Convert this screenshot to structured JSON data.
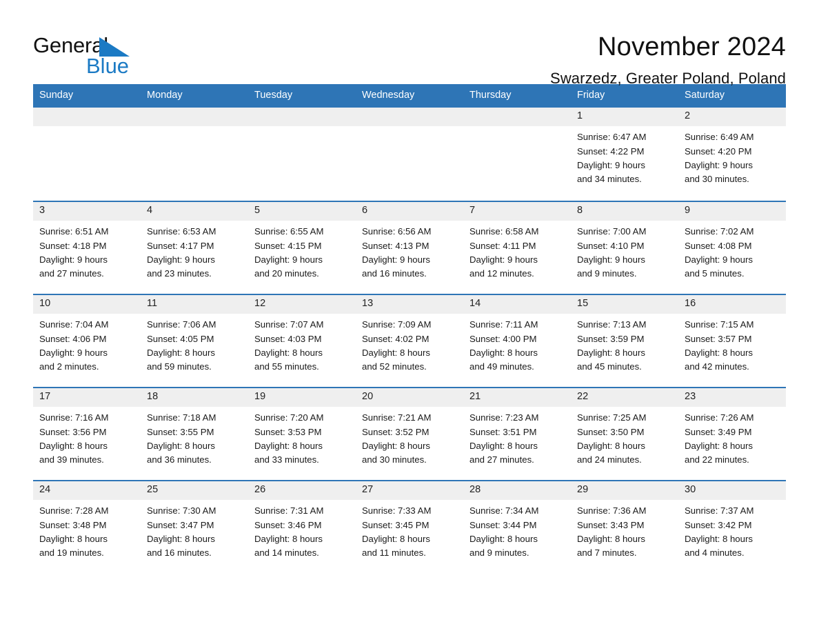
{
  "brand": {
    "name_part1": "General",
    "name_part2": "Blue",
    "accent_color": "#1b7ac4"
  },
  "header": {
    "title": "November 2024",
    "location": "Swarzedz, Greater Poland, Poland"
  },
  "theme": {
    "header_blue": "#2e75b6",
    "day_band_gray": "#efefef"
  },
  "weekdays": [
    "Sunday",
    "Monday",
    "Tuesday",
    "Wednesday",
    "Thursday",
    "Friday",
    "Saturday"
  ],
  "weeks": [
    [
      {
        "day": "",
        "lines": []
      },
      {
        "day": "",
        "lines": []
      },
      {
        "day": "",
        "lines": []
      },
      {
        "day": "",
        "lines": []
      },
      {
        "day": "",
        "lines": []
      },
      {
        "day": "1",
        "lines": [
          "Sunrise: 6:47 AM",
          "Sunset: 4:22 PM",
          "Daylight: 9 hours",
          "and 34 minutes."
        ]
      },
      {
        "day": "2",
        "lines": [
          "Sunrise: 6:49 AM",
          "Sunset: 4:20 PM",
          "Daylight: 9 hours",
          "and 30 minutes."
        ]
      }
    ],
    [
      {
        "day": "3",
        "lines": [
          "Sunrise: 6:51 AM",
          "Sunset: 4:18 PM",
          "Daylight: 9 hours",
          "and 27 minutes."
        ]
      },
      {
        "day": "4",
        "lines": [
          "Sunrise: 6:53 AM",
          "Sunset: 4:17 PM",
          "Daylight: 9 hours",
          "and 23 minutes."
        ]
      },
      {
        "day": "5",
        "lines": [
          "Sunrise: 6:55 AM",
          "Sunset: 4:15 PM",
          "Daylight: 9 hours",
          "and 20 minutes."
        ]
      },
      {
        "day": "6",
        "lines": [
          "Sunrise: 6:56 AM",
          "Sunset: 4:13 PM",
          "Daylight: 9 hours",
          "and 16 minutes."
        ]
      },
      {
        "day": "7",
        "lines": [
          "Sunrise: 6:58 AM",
          "Sunset: 4:11 PM",
          "Daylight: 9 hours",
          "and 12 minutes."
        ]
      },
      {
        "day": "8",
        "lines": [
          "Sunrise: 7:00 AM",
          "Sunset: 4:10 PM",
          "Daylight: 9 hours",
          "and 9 minutes."
        ]
      },
      {
        "day": "9",
        "lines": [
          "Sunrise: 7:02 AM",
          "Sunset: 4:08 PM",
          "Daylight: 9 hours",
          "and 5 minutes."
        ]
      }
    ],
    [
      {
        "day": "10",
        "lines": [
          "Sunrise: 7:04 AM",
          "Sunset: 4:06 PM",
          "Daylight: 9 hours",
          "and 2 minutes."
        ]
      },
      {
        "day": "11",
        "lines": [
          "Sunrise: 7:06 AM",
          "Sunset: 4:05 PM",
          "Daylight: 8 hours",
          "and 59 minutes."
        ]
      },
      {
        "day": "12",
        "lines": [
          "Sunrise: 7:07 AM",
          "Sunset: 4:03 PM",
          "Daylight: 8 hours",
          "and 55 minutes."
        ]
      },
      {
        "day": "13",
        "lines": [
          "Sunrise: 7:09 AM",
          "Sunset: 4:02 PM",
          "Daylight: 8 hours",
          "and 52 minutes."
        ]
      },
      {
        "day": "14",
        "lines": [
          "Sunrise: 7:11 AM",
          "Sunset: 4:00 PM",
          "Daylight: 8 hours",
          "and 49 minutes."
        ]
      },
      {
        "day": "15",
        "lines": [
          "Sunrise: 7:13 AM",
          "Sunset: 3:59 PM",
          "Daylight: 8 hours",
          "and 45 minutes."
        ]
      },
      {
        "day": "16",
        "lines": [
          "Sunrise: 7:15 AM",
          "Sunset: 3:57 PM",
          "Daylight: 8 hours",
          "and 42 minutes."
        ]
      }
    ],
    [
      {
        "day": "17",
        "lines": [
          "Sunrise: 7:16 AM",
          "Sunset: 3:56 PM",
          "Daylight: 8 hours",
          "and 39 minutes."
        ]
      },
      {
        "day": "18",
        "lines": [
          "Sunrise: 7:18 AM",
          "Sunset: 3:55 PM",
          "Daylight: 8 hours",
          "and 36 minutes."
        ]
      },
      {
        "day": "19",
        "lines": [
          "Sunrise: 7:20 AM",
          "Sunset: 3:53 PM",
          "Daylight: 8 hours",
          "and 33 minutes."
        ]
      },
      {
        "day": "20",
        "lines": [
          "Sunrise: 7:21 AM",
          "Sunset: 3:52 PM",
          "Daylight: 8 hours",
          "and 30 minutes."
        ]
      },
      {
        "day": "21",
        "lines": [
          "Sunrise: 7:23 AM",
          "Sunset: 3:51 PM",
          "Daylight: 8 hours",
          "and 27 minutes."
        ]
      },
      {
        "day": "22",
        "lines": [
          "Sunrise: 7:25 AM",
          "Sunset: 3:50 PM",
          "Daylight: 8 hours",
          "and 24 minutes."
        ]
      },
      {
        "day": "23",
        "lines": [
          "Sunrise: 7:26 AM",
          "Sunset: 3:49 PM",
          "Daylight: 8 hours",
          "and 22 minutes."
        ]
      }
    ],
    [
      {
        "day": "24",
        "lines": [
          "Sunrise: 7:28 AM",
          "Sunset: 3:48 PM",
          "Daylight: 8 hours",
          "and 19 minutes."
        ]
      },
      {
        "day": "25",
        "lines": [
          "Sunrise: 7:30 AM",
          "Sunset: 3:47 PM",
          "Daylight: 8 hours",
          "and 16 minutes."
        ]
      },
      {
        "day": "26",
        "lines": [
          "Sunrise: 7:31 AM",
          "Sunset: 3:46 PM",
          "Daylight: 8 hours",
          "and 14 minutes."
        ]
      },
      {
        "day": "27",
        "lines": [
          "Sunrise: 7:33 AM",
          "Sunset: 3:45 PM",
          "Daylight: 8 hours",
          "and 11 minutes."
        ]
      },
      {
        "day": "28",
        "lines": [
          "Sunrise: 7:34 AM",
          "Sunset: 3:44 PM",
          "Daylight: 8 hours",
          "and 9 minutes."
        ]
      },
      {
        "day": "29",
        "lines": [
          "Sunrise: 7:36 AM",
          "Sunset: 3:43 PM",
          "Daylight: 8 hours",
          "and 7 minutes."
        ]
      },
      {
        "day": "30",
        "lines": [
          "Sunrise: 7:37 AM",
          "Sunset: 3:42 PM",
          "Daylight: 8 hours",
          "and 4 minutes."
        ]
      }
    ]
  ]
}
